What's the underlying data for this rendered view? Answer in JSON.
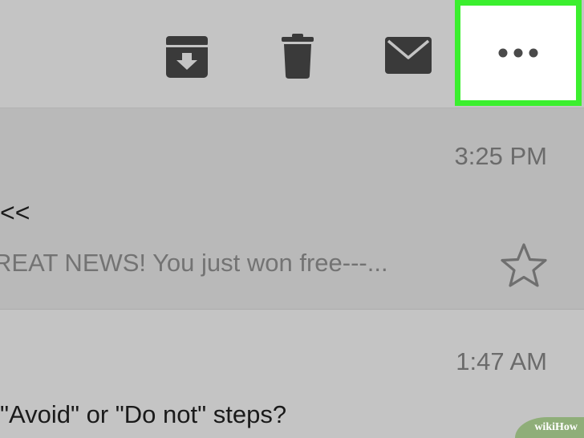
{
  "toolbar": {
    "archive_icon": "archive-icon",
    "trash_icon": "trash-icon",
    "mail_icon": "mail-icon",
    "more_icon": "more-horizontal-icon",
    "highlight_color": "#3bef2e"
  },
  "emails": [
    {
      "time": "3:25 PM",
      "sender": "<<",
      "preview": "REAT NEWS! You just won free---...",
      "star_icon": "star-outline-icon"
    },
    {
      "time": "1:47 AM",
      "subject": "\"Avoid\" or \"Do not\" steps?"
    }
  ],
  "watermark": {
    "text": "wikiHow"
  }
}
